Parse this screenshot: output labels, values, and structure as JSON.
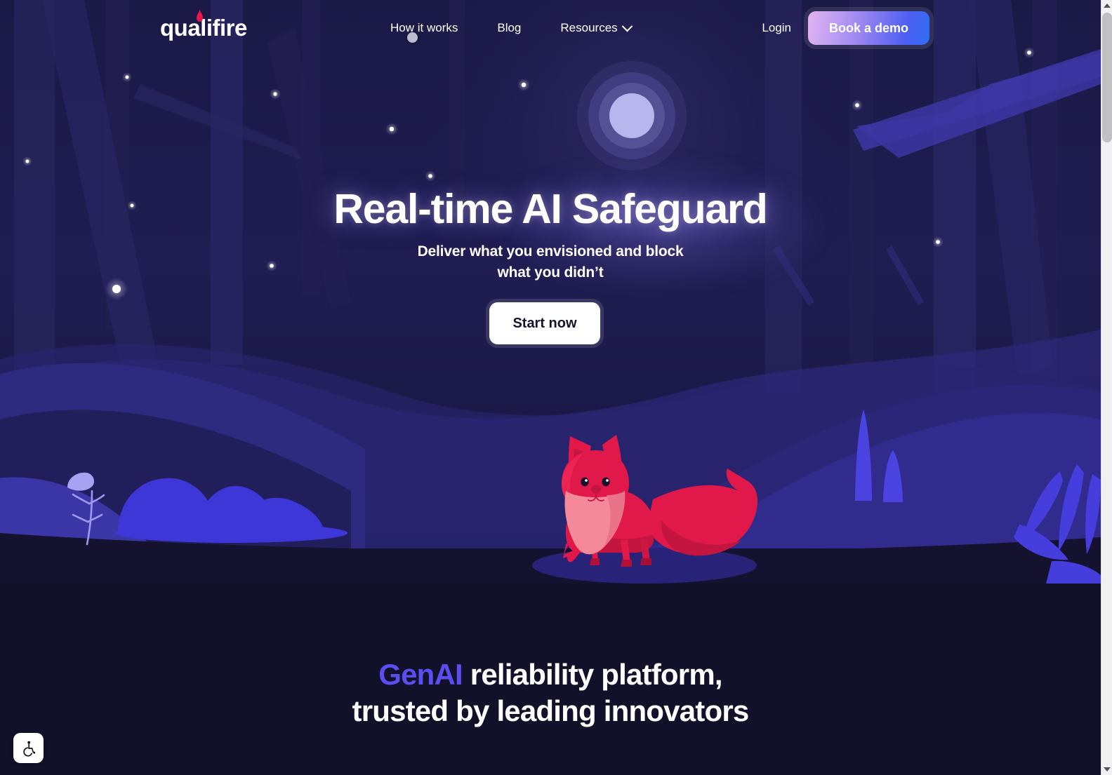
{
  "site": {
    "logo_text": "qualifire",
    "logo_icon": "flame-dot"
  },
  "header": {
    "nav": [
      {
        "label": "How it works",
        "icon": null
      },
      {
        "label": "Blog",
        "icon": null
      },
      {
        "label": "Resources",
        "icon": "chevron-down-icon"
      }
    ],
    "login_label": "Login",
    "demo_label": "Book a demo"
  },
  "hero": {
    "headline": "Real-time AI Safeguard",
    "subhead_line1": "Deliver what you envisioned and block",
    "subhead_line2": "what you didn’t",
    "cta_label": "Start now",
    "illustration": "night-forest-with-fox"
  },
  "section2": {
    "title_accent": "GenAI",
    "title_rest": " reliability platform,",
    "title_line2": "trusted by leading innovators"
  },
  "accessibility": {
    "icon": "wheelchair-accessibility-icon",
    "label": "Accessibility options"
  },
  "scrollbar": {
    "up_icon": "scroll-up-arrow-icon",
    "down_icon": "scroll-down-arrow-icon"
  },
  "colors": {
    "accent_purple": "#5b4ef0",
    "brand_red": "#e8174b",
    "hero_sky": "#1d1b4c",
    "section_bg": "#12112a",
    "cta_bg": "#ffffff",
    "demo_gradient_from": "#e3b4f0",
    "demo_gradient_to": "#2f6df5",
    "fox_body": "#e01a45",
    "fox_belly": "#f4899a",
    "moon_core": "#b9b6ee"
  }
}
